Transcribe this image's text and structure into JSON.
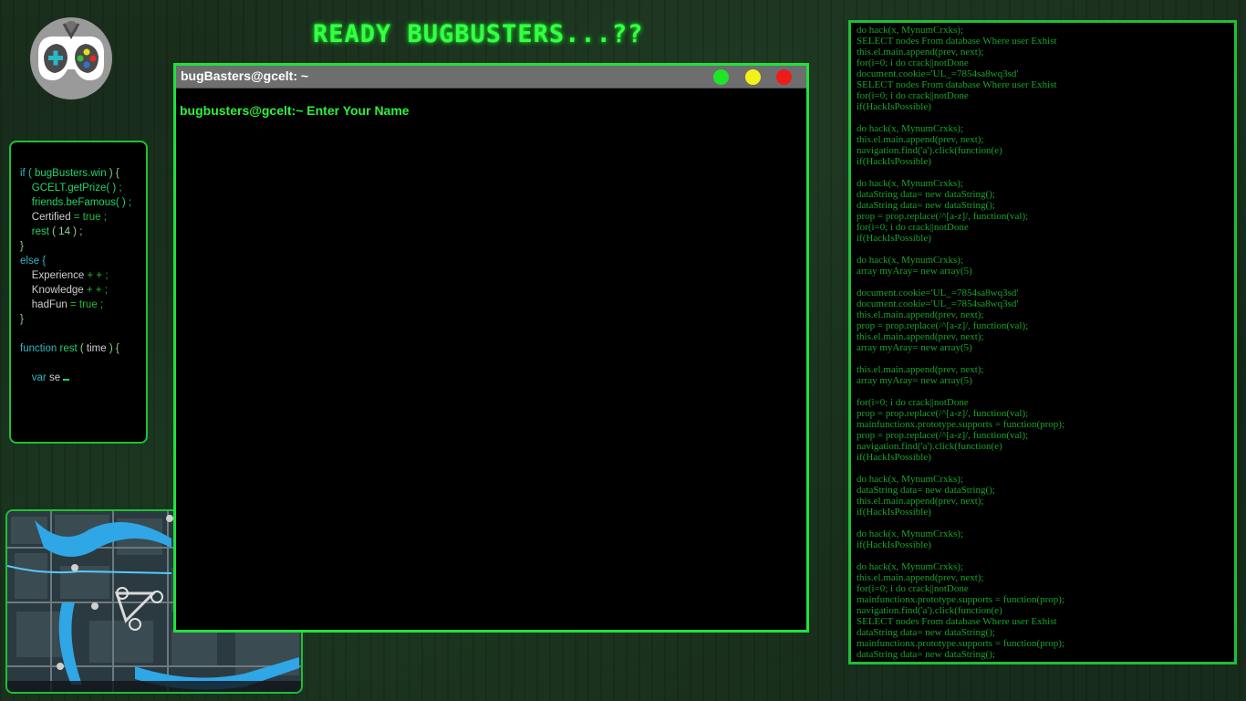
{
  "title": "READY BUGBUSTERS...??",
  "logo": {
    "icon": "gamepad-emblem-icon"
  },
  "code_panel": {
    "lines": [
      [
        [
          "if ( ",
          "kw"
        ],
        [
          "bugBusters.win",
          "id"
        ],
        [
          " ) {",
          "punc"
        ]
      ],
      [
        [
          "    GCELT",
          "id"
        ],
        [
          ".getPrize( ) ;",
          "id"
        ]
      ],
      [
        [
          "    friends",
          "id"
        ],
        [
          ".beFamous( ) ;",
          "id"
        ]
      ],
      [
        [
          "    Certified",
          "plain"
        ],
        [
          " = true ;",
          "val"
        ]
      ],
      [
        [
          "    rest ",
          "id"
        ],
        [
          "( 14 ) ;",
          "punc"
        ]
      ],
      [
        [
          "}",
          "punc"
        ]
      ],
      [
        [
          "else {",
          "kw"
        ]
      ],
      [
        [
          "    Experience",
          "plain"
        ],
        [
          " + + ;",
          "val"
        ]
      ],
      [
        [
          "    Knowledge",
          "plain"
        ],
        [
          " + + ;",
          "val"
        ]
      ],
      [
        [
          "    hadFun",
          "plain"
        ],
        [
          " = true ;",
          "val"
        ]
      ],
      [
        [
          "}",
          "punc"
        ]
      ],
      [],
      [
        [
          "function ",
          "kw"
        ],
        [
          "rest ",
          "id"
        ],
        [
          "( ",
          "punc"
        ],
        [
          "time",
          "plain"
        ],
        [
          " ) {",
          "punc"
        ]
      ],
      [],
      [
        [
          "    var ",
          "kw"
        ],
        [
          "se",
          "plain"
        ]
      ]
    ]
  },
  "terminal": {
    "window_title": "bugBasters@gcelt: ~",
    "prompt": "bugbusters@gcelt:~ Enter Your Name",
    "buttons": {
      "green": "#1ee52a",
      "yellow": "#f2f21a",
      "red": "#ef1a1a"
    }
  },
  "stream": {
    "lines": [
      "do hack(x, MynumCrxks);",
      "SELECT nodes From database Where user Exhist",
      "this.el.main.append(prev, next);",
      "for(i=0; i do crack||notDone",
      "document.cookie='UL_=7854sa8wq3sd'",
      "SELECT nodes From database Where user Exhist",
      "for(i=0; i do crack||notDone",
      "if(HackIsPossible)",
      "",
      "do hack(x, MynumCrxks);",
      "this.el.main.append(prev, next);",
      "navigation.find('a').click(function(e)",
      "if(HackIsPossible)",
      "",
      "do hack(x, MynumCrxks);",
      "dataString data= new dataString();",
      "dataString data= new dataString();",
      "prop = prop.replace(/^[a-z]/, function(val);",
      "for(i=0; i do crack||notDone",
      "if(HackIsPossible)",
      "",
      "do hack(x, MynumCrxks);",
      "array myAray= new array(5)",
      "",
      "document.cookie='UL_=7854sa8wq3sd'",
      "document.cookie='UL_=7854sa8wq3sd'",
      "this.el.main.append(prev, next);",
      "prop = prop.replace(/^[a-z]/, function(val);",
      "this.el.main.append(prev, next);",
      "array myAray= new array(5)",
      "",
      "this.el.main.append(prev, next);",
      "array myAray= new array(5)",
      "",
      "for(i=0; i do crack||notDone",
      "prop = prop.replace(/^[a-z]/, function(val);",
      "mainfunctionx.prototype.supports = function(prop);",
      "prop = prop.replace(/^[a-z]/, function(val);",
      "navigation.find('a').click(function(e)",
      "if(HackIsPossible)",
      "",
      "do hack(x, MynumCrxks);",
      "dataString data= new dataString();",
      "this.el.main.append(prev, next);",
      "if(HackIsPossible)",
      "",
      "do hack(x, MynumCrxks);",
      "if(HackIsPossible)",
      "",
      "do hack(x, MynumCrxks);",
      "this.el.main.append(prev, next);",
      "for(i=0; i do crack||notDone",
      "mainfunctionx.prototype.supports = function(prop);",
      "navigation.find('a').click(function(e)",
      "SELECT nodes From database Where user Exhist",
      "dataString data= new dataString();",
      "mainfunctionx.prototype.supports = function(prop);",
      "dataString data= new dataString();"
    ]
  }
}
